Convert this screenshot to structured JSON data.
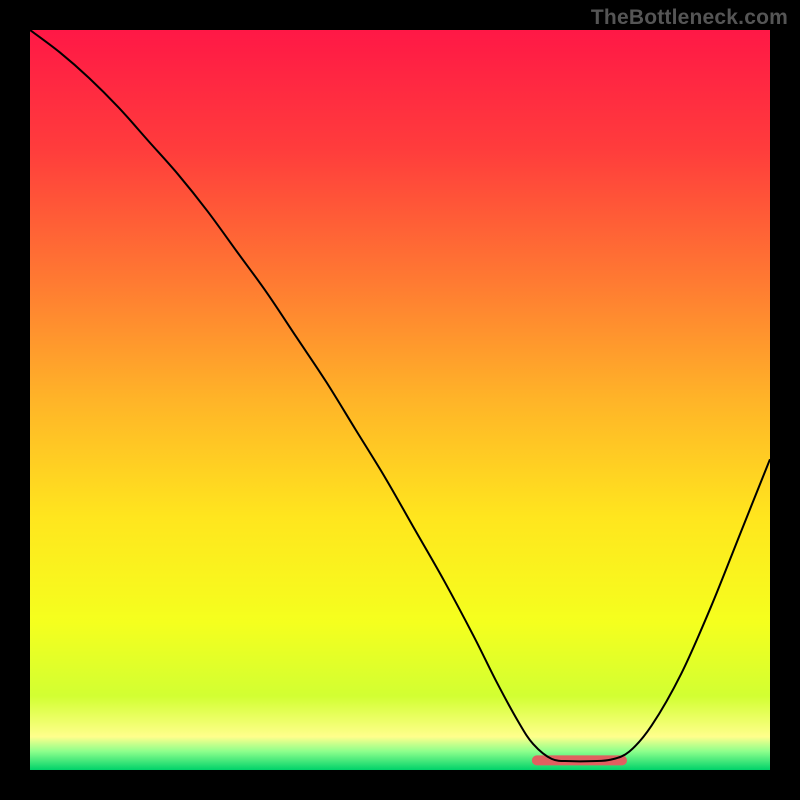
{
  "attribution": "TheBottleneck.com",
  "chart_data": {
    "type": "line",
    "title": "",
    "xlabel": "",
    "ylabel": "",
    "xlim": [
      0,
      100
    ],
    "ylim": [
      0,
      100
    ],
    "gradient_stops": [
      {
        "offset": 0.0,
        "color": "#ff1846"
      },
      {
        "offset": 0.16,
        "color": "#ff3c3c"
      },
      {
        "offset": 0.34,
        "color": "#ff7a32"
      },
      {
        "offset": 0.5,
        "color": "#ffb428"
      },
      {
        "offset": 0.66,
        "color": "#ffe61e"
      },
      {
        "offset": 0.8,
        "color": "#f5ff1e"
      },
      {
        "offset": 0.9,
        "color": "#d2ff32"
      },
      {
        "offset": 0.955,
        "color": "#ffff8c"
      },
      {
        "offset": 0.975,
        "color": "#8cff8c"
      },
      {
        "offset": 1.0,
        "color": "#00d26a"
      }
    ],
    "series": [
      {
        "name": "bottleneck-curve",
        "color": "#000000",
        "strokeWidth": 2,
        "x": [
          0,
          4,
          8,
          12,
          16,
          20,
          24,
          28,
          32,
          36,
          40,
          44,
          48,
          52,
          56,
          60,
          63,
          66,
          68,
          70.5,
          73,
          76,
          78.5,
          81,
          84,
          88,
          92,
          96,
          100
        ],
        "y": [
          100,
          97,
          93.5,
          89.5,
          85,
          80.5,
          75.5,
          70,
          64.5,
          58.5,
          52.5,
          46,
          39.5,
          32.5,
          25.5,
          18,
          12,
          6.5,
          3.5,
          1.5,
          1.2,
          1.2,
          1.4,
          2.5,
          6,
          13,
          22,
          32,
          42
        ]
      }
    ],
    "flat_band": {
      "color": "#e06060",
      "y": 1.3,
      "x_start": 68.5,
      "x_end": 80,
      "thickness": 10
    }
  }
}
